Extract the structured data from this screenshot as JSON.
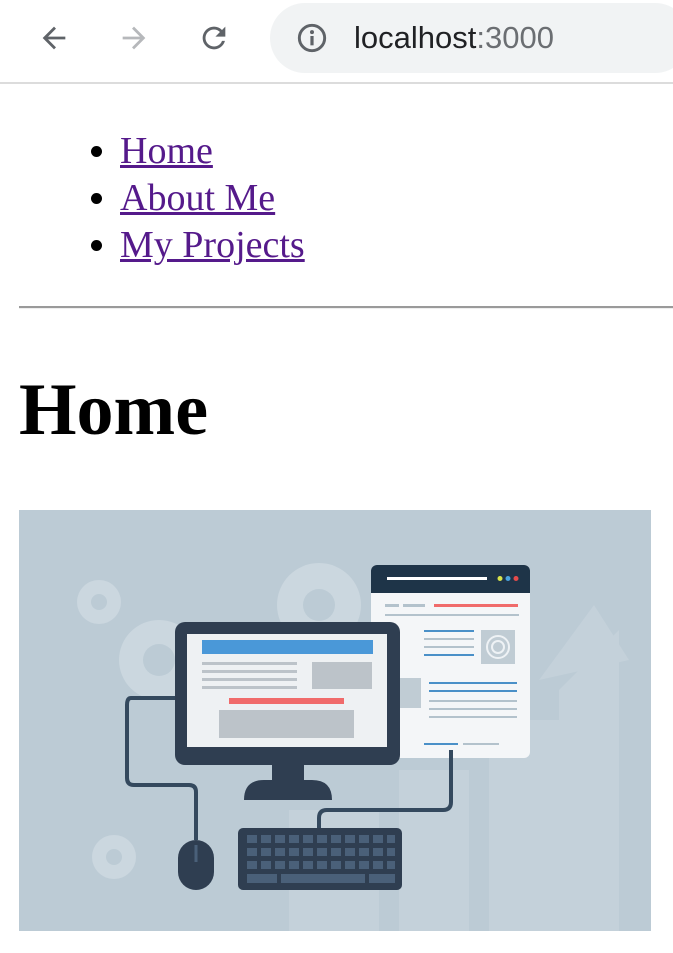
{
  "browser": {
    "url_host": "localhost",
    "url_port": ":3000",
    "icons": {
      "back": "arrow-left-icon",
      "forward": "arrow-right-icon",
      "reload": "reload-icon",
      "site_info": "info-circle-icon"
    }
  },
  "nav": {
    "items": [
      {
        "label": "Home"
      },
      {
        "label": "About Me"
      },
      {
        "label": "My Projects"
      }
    ],
    "link_color": "#551a8b"
  },
  "main": {
    "title": "Home",
    "hero_image": {
      "name": "computer-illustration",
      "background": "#bccbd5"
    }
  }
}
